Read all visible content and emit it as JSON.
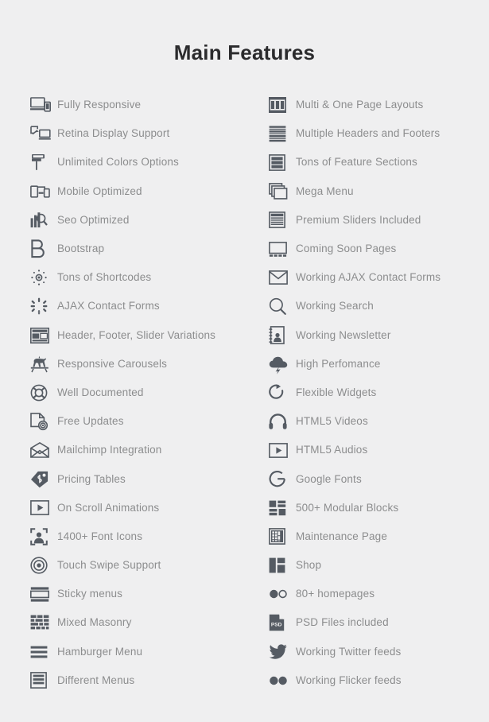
{
  "page": {
    "title": "Main Features",
    "background_color": "#efeff0",
    "title_color": "#2b2b2d",
    "icon_color": "#555b63",
    "label_color": "#8c8d8e"
  },
  "columns": {
    "left": [
      {
        "label": "Fully Responsive",
        "icon": "desktop-mobile-icon"
      },
      {
        "label": "Retina Display Support",
        "icon": "retina-display-icon"
      },
      {
        "label": "Unlimited Colors Options",
        "icon": "paint-roller-icon"
      },
      {
        "label": "Mobile Optimized",
        "icon": "mobile-devices-icon"
      },
      {
        "label": "Seo Optimized",
        "icon": "seo-chart-magnifier-icon"
      },
      {
        "label": "Bootstrap",
        "icon": "bootstrap-b-icon"
      },
      {
        "label": "Tons of Shortcodes",
        "icon": "shortcode-sun-icon"
      },
      {
        "label": "AJAX Contact Forms",
        "icon": "ajax-spinner-icon"
      },
      {
        "label": "Header, Footer, Slider Variations",
        "icon": "layout-variations-icon"
      },
      {
        "label": "Responsive Carousels",
        "icon": "carousel-horse-icon"
      },
      {
        "label": "Well Documented",
        "icon": "lifebuoy-icon"
      },
      {
        "label": "Free Updates",
        "icon": "file-update-icon"
      },
      {
        "label": "Mailchimp Integration",
        "icon": "open-envelope-icon"
      },
      {
        "label": "Pricing Tables",
        "icon": "price-tag-icon"
      },
      {
        "label": "On Scroll Animations",
        "icon": "play-frame-icon"
      },
      {
        "label": "1400+ Font Icons",
        "icon": "user-focus-icon"
      },
      {
        "label": "Touch Swipe Support",
        "icon": "target-rings-icon"
      },
      {
        "label": "Sticky menus",
        "icon": "sticky-menu-icon"
      },
      {
        "label": "Mixed Masonry",
        "icon": "masonry-bricks-icon"
      },
      {
        "label": "Hamburger Menu",
        "icon": "hamburger-menu-icon"
      },
      {
        "label": "Different Menus",
        "icon": "menu-panel-icon"
      }
    ],
    "right": [
      {
        "label": "Multi & One Page Layouts",
        "icon": "multi-column-layout-icon"
      },
      {
        "label": "Multiple Headers and Footers",
        "icon": "stacked-lines-icon"
      },
      {
        "label": "Tons of Feature Sections",
        "icon": "section-blocks-icon"
      },
      {
        "label": "Mega Menu",
        "icon": "stacked-windows-icon"
      },
      {
        "label": "Premium Sliders Included",
        "icon": "slider-panel-icon"
      },
      {
        "label": "Coming Soon Pages",
        "icon": "coming-soon-screen-icon"
      },
      {
        "label": "Working AJAX Contact Forms",
        "icon": "envelope-icon"
      },
      {
        "label": "Working Search",
        "icon": "search-icon"
      },
      {
        "label": "Working Newsletter",
        "icon": "newsletter-book-icon"
      },
      {
        "label": "High Perfomance",
        "icon": "cloud-lightning-icon"
      },
      {
        "label": "Flexible Widgets",
        "icon": "refresh-arrow-icon"
      },
      {
        "label": "HTML5 Videos",
        "icon": "headphones-icon"
      },
      {
        "label": "HTML5 Audios",
        "icon": "play-frame-icon"
      },
      {
        "label": "Google Fonts",
        "icon": "google-g-icon"
      },
      {
        "label": "500+ Modular Blocks",
        "icon": "modular-blocks-icon"
      },
      {
        "label": "Maintenance Page",
        "icon": "maintenance-grid-icon"
      },
      {
        "label": "Shop",
        "icon": "shop-layout-icon"
      },
      {
        "label": "80+ homepages",
        "icon": "two-dots-half-icon"
      },
      {
        "label": "PSD Files included",
        "icon": "psd-file-icon"
      },
      {
        "label": "Working Twitter feeds",
        "icon": "twitter-bird-icon"
      },
      {
        "label": "Working Flicker feeds",
        "icon": "flickr-dots-icon"
      }
    ]
  }
}
